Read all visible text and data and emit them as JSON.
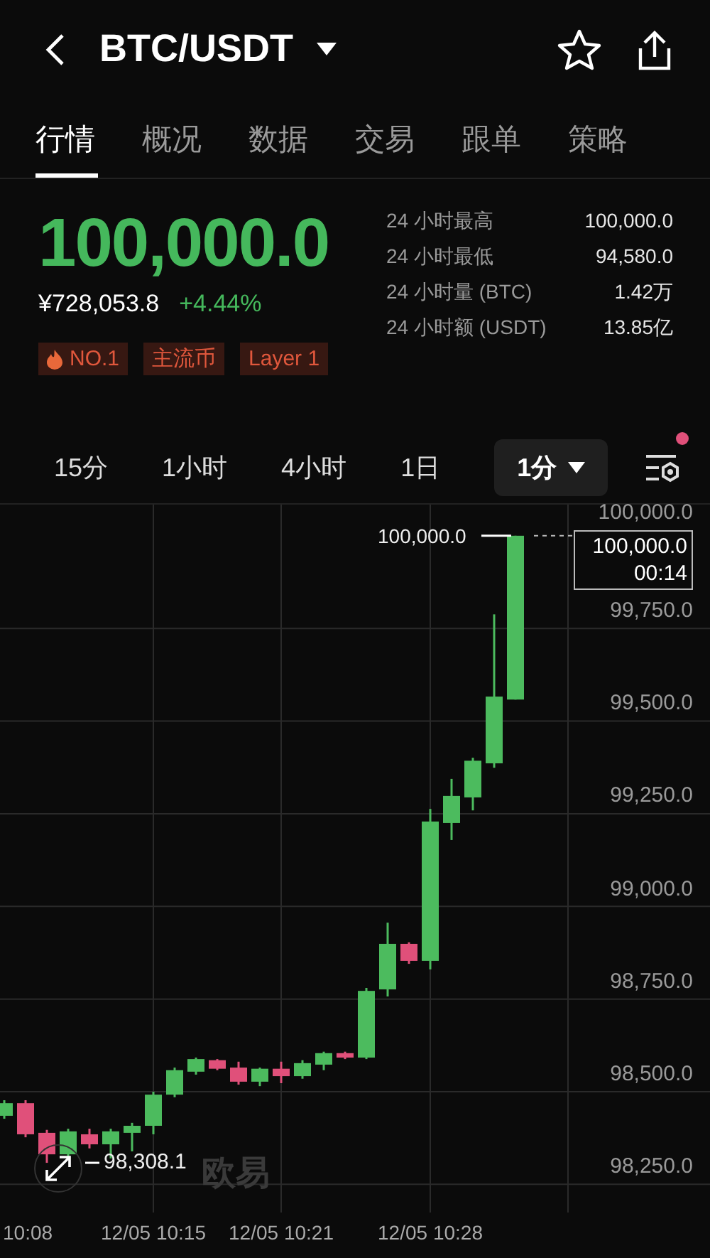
{
  "header": {
    "title": "BTC/USDT"
  },
  "tabs": [
    {
      "label": "行情",
      "selected": true
    },
    {
      "label": "概况",
      "selected": false
    },
    {
      "label": "数据",
      "selected": false
    },
    {
      "label": "交易",
      "selected": false
    },
    {
      "label": "跟单",
      "selected": false
    },
    {
      "label": "策略",
      "selected": false
    }
  ],
  "price": {
    "last": "100,000.0",
    "cny": "¥728,053.8",
    "change": "+4.44%"
  },
  "tags": [
    {
      "label": "NO.1",
      "kind": "hot"
    },
    {
      "label": "主流币",
      "kind": "plain"
    },
    {
      "label": "Layer 1",
      "kind": "plain"
    }
  ],
  "stats": [
    {
      "label": "24 小时最高",
      "value": "100,000.0"
    },
    {
      "label": "24 小时最低",
      "value": "94,580.0"
    },
    {
      "label": "24 小时量 (BTC)",
      "value": "1.42万"
    },
    {
      "label": "24 小时额 (USDT)",
      "value": "13.85亿"
    }
  ],
  "intervals": [
    {
      "label": "15分",
      "selected": false
    },
    {
      "label": "1小时",
      "selected": false
    },
    {
      "label": "4小时",
      "selected": false
    },
    {
      "label": "1日",
      "selected": false
    },
    {
      "label": "1分",
      "selected": true
    }
  ],
  "indicator_settings": {
    "notice": true
  },
  "chart": {
    "x_labels": [
      "10:08",
      "12/05 10:15",
      "12/05 10:21",
      "12/05 10:28"
    ],
    "high_marker": "100,000.0",
    "low_marker": "98,308.1",
    "last_price": "100,000.0",
    "countdown": "00:14",
    "watermark": "欧易",
    "chart_data": {
      "type": "candlestick",
      "ohlc": [
        [
          98435,
          98477,
          98427,
          98469
        ],
        [
          98469,
          98477,
          98377,
          98385
        ],
        [
          98389,
          98397,
          98308.1,
          98331
        ],
        [
          98331,
          98400,
          98323,
          98393
        ],
        [
          98385,
          98400,
          98347,
          98358
        ],
        [
          98358,
          98400,
          98320,
          98393
        ],
        [
          98389,
          98416,
          98339,
          98408
        ],
        [
          98408,
          98500,
          98385,
          98492
        ],
        [
          98492,
          98565,
          98485,
          98558
        ],
        [
          98554,
          98592,
          98546,
          98588
        ],
        [
          98585,
          98588,
          98558,
          98562
        ],
        [
          98565,
          98581,
          98519,
          98527
        ],
        [
          98527,
          98565,
          98515,
          98562
        ],
        [
          98562,
          98581,
          98523,
          98542
        ],
        [
          98542,
          98585,
          98535,
          98577
        ],
        [
          98573,
          98608,
          98558,
          98604
        ],
        [
          98604,
          98608,
          98588,
          98592
        ],
        [
          98592,
          98780,
          98588,
          98772
        ],
        [
          98776,
          98956,
          98757,
          98899
        ],
        [
          98899,
          98903,
          98845,
          98853
        ],
        [
          98853,
          99263,
          98830,
          99229
        ],
        [
          99225,
          99344,
          99179,
          99298
        ],
        [
          99294,
          99401,
          99259,
          99393
        ],
        [
          99386,
          99788,
          99374,
          99566
        ],
        [
          99558,
          100000,
          99558,
          100000
        ]
      ],
      "ylim": [
        98174,
        100084
      ],
      "grid": true,
      "yticks": [
        {
          "value": 100000,
          "label": "100,000.0"
        },
        {
          "value": 99750,
          "label": "99,750.0"
        },
        {
          "value": 99500,
          "label": "99,500.0"
        },
        {
          "value": 99250,
          "label": "99,250.0"
        },
        {
          "value": 99000,
          "label": "99,000.0"
        },
        {
          "value": 98750,
          "label": "98,750.0"
        },
        {
          "value": 98500,
          "label": "98,500.0"
        },
        {
          "value": 98250,
          "label": "98,250.0"
        }
      ]
    }
  }
}
